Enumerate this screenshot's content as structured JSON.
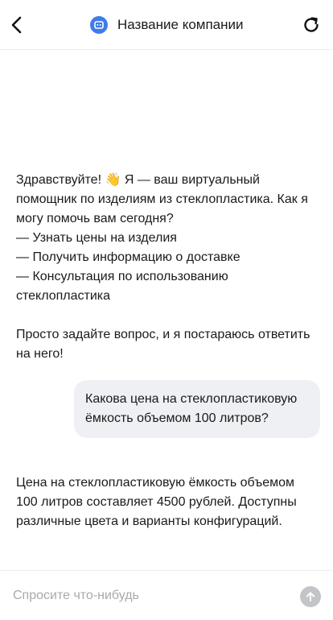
{
  "header": {
    "title": "Название компании",
    "back_icon": "chevron-left-icon",
    "avatar_icon": "bot-icon",
    "refresh_icon": "refresh-icon",
    "accent_color": "#3f7bea"
  },
  "messages": [
    {
      "role": "assistant",
      "text": "Здравствуйте! 👋 Я — ваш виртуальный помощник по изделиям из стеклопластика. Как я могу помочь вам сегодня?\n— Узнать цены на изделия\n— Получить информацию о доставке\n— Консультация по использованию стеклопластика\n\nПросто задайте вопрос, и я постараюсь ответить на него!"
    },
    {
      "role": "user",
      "text": "Какова цена на стеклопластиковую ёмкость объемом 100 литров?"
    },
    {
      "role": "assistant",
      "text": "Цена на стеклопластиковую ёмкость объемом 100 литров составляет 4500 рублей. Доступны различные цвета и варианты конфигураций."
    }
  ],
  "composer": {
    "placeholder": "Спросите что-нибудь",
    "value": "",
    "send_icon": "arrow-up-icon"
  }
}
